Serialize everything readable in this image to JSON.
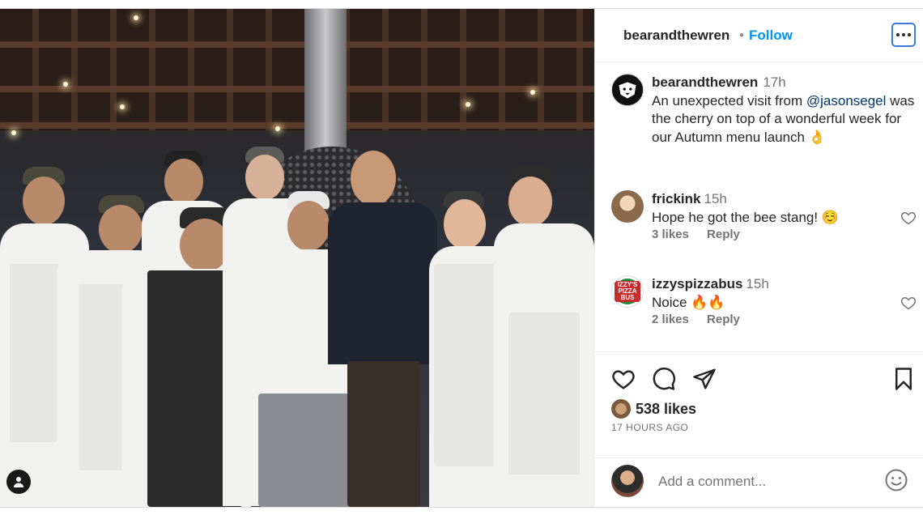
{
  "header": {
    "username": "bearandthewren",
    "separator": "•",
    "follow_label": "Follow",
    "more_icon": "more-options-icon"
  },
  "caption": {
    "username": "bearandthewren",
    "time": "17h",
    "text_before": "An unexpected visit from ",
    "mention": "@jasonsegel",
    "text_after": " was the cherry on top of a wonderful week for our Autumn menu launch 👌"
  },
  "comments": [
    {
      "username": "frickink",
      "time": "15h",
      "text": "Hope he got the bee stang! ☺️",
      "likes": "3 likes",
      "reply": "Reply"
    },
    {
      "username": "izzyspizzabus",
      "time": "15h",
      "text": "Noice 🔥🔥",
      "likes": "2 likes",
      "reply": "Reply",
      "avatar_text": "IZZY'S PIZZA BUS"
    }
  ],
  "actions": {
    "icons": [
      "heart-icon",
      "comment-icon",
      "share-icon",
      "bookmark-icon"
    ]
  },
  "likes": "538 likes",
  "posted_ago": "17 HOURS AGO",
  "add_comment": {
    "placeholder": "Add a comment...",
    "emoji_icon": "emoji-icon"
  },
  "colors": {
    "accent": "#0095f6",
    "mention": "#00376b",
    "muted": "#737373",
    "text": "#262626"
  }
}
